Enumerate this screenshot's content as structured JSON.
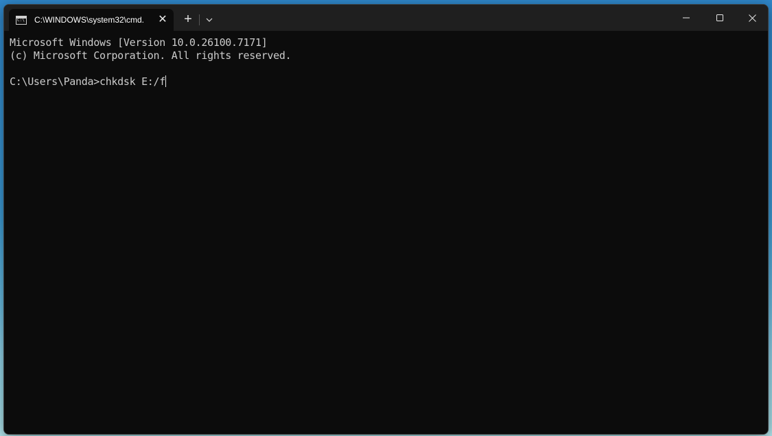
{
  "window": {
    "tab_title": "C:\\WINDOWS\\system32\\cmd.",
    "tab_close": "✕",
    "new_tab": "+",
    "minimize_label": "Minimize",
    "maximize_label": "Maximize",
    "close_label": "Close"
  },
  "terminal": {
    "lines": [
      "Microsoft Windows [Version 10.0.26100.7171]",
      "(c) Microsoft Corporation. All rights reserved.",
      "",
      "C:\\Users\\Panda>chkdsk E:/f"
    ]
  },
  "icons": {
    "tab_icon": "cmd-icon",
    "dropdown": "chevron-down-icon"
  },
  "colors": {
    "terminal_bg": "#0c0c0c",
    "titlebar_bg": "#1f1f1f",
    "text": "#cccccc"
  }
}
